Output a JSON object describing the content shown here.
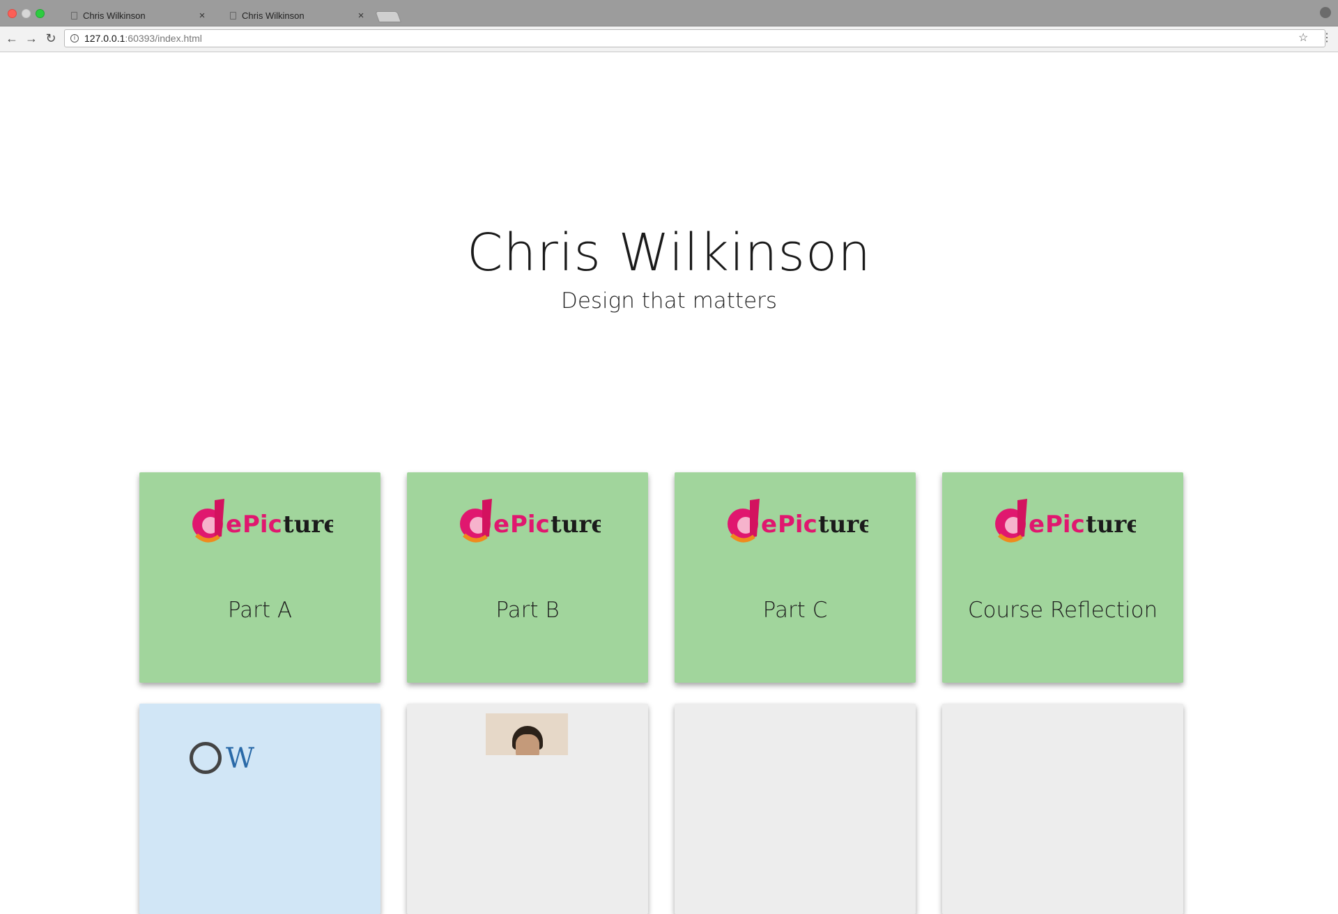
{
  "browser": {
    "tabs": [
      {
        "title": "Chris Wilkinson",
        "active": true
      },
      {
        "title": "Chris Wilkinson",
        "active": false
      }
    ],
    "url_host": "127.0.0.1",
    "url_path": ":60393/index.html"
  },
  "hero": {
    "title": "Chris Wilkinson",
    "subtitle": "Design that matters"
  },
  "logo": {
    "d": "d",
    "text_e": "e",
    "text_pic": "Pic",
    "text_ture": "ture"
  },
  "cards": [
    {
      "label": "Part A"
    },
    {
      "label": "Part B"
    },
    {
      "label": "Part C"
    },
    {
      "label": "Course Reflection"
    }
  ],
  "second_row": {
    "wp_text": "W"
  },
  "colors": {
    "card_green": "#a1d59c",
    "card_blue": "#d1e6f6",
    "card_grey": "#ededed",
    "logo_pink": "#e0176f",
    "logo_orange": "#f08a1c"
  }
}
